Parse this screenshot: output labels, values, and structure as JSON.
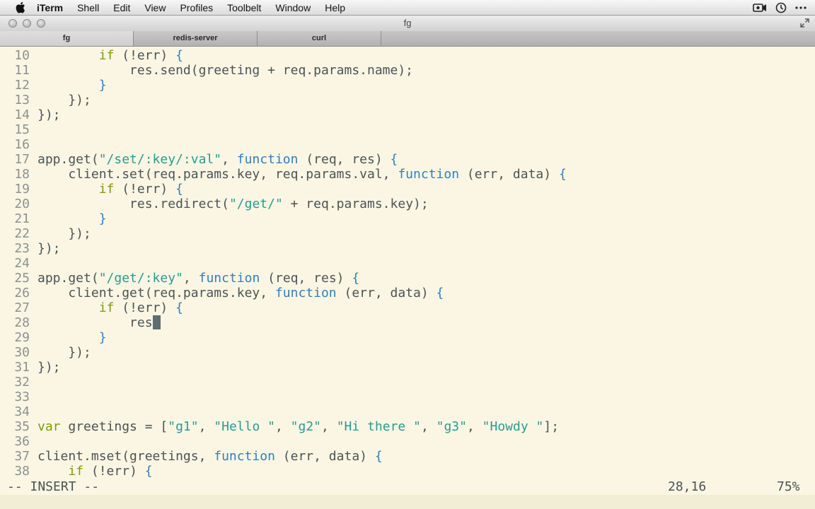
{
  "menubar": {
    "items": [
      "iTerm",
      "Shell",
      "Edit",
      "View",
      "Profiles",
      "Toolbelt",
      "Window",
      "Help"
    ]
  },
  "window": {
    "title": "fg",
    "tabs": [
      "fg",
      "redis-server",
      "curl"
    ]
  },
  "editor": {
    "lines": [
      {
        "num": "10",
        "segs": [
          {
            "t": "        "
          },
          {
            "t": "if",
            "c": "kw"
          },
          {
            "t": " (!err) "
          },
          {
            "t": "{",
            "c": "br"
          }
        ]
      },
      {
        "num": "11",
        "segs": [
          {
            "t": "            res.send(greeting + req.params.name);"
          }
        ]
      },
      {
        "num": "12",
        "segs": [
          {
            "t": "        "
          },
          {
            "t": "}",
            "c": "br"
          }
        ]
      },
      {
        "num": "13",
        "segs": [
          {
            "t": "    });"
          }
        ]
      },
      {
        "num": "14",
        "segs": [
          {
            "t": "});"
          }
        ]
      },
      {
        "num": "15",
        "segs": []
      },
      {
        "num": "16",
        "segs": []
      },
      {
        "num": "17",
        "segs": [
          {
            "t": "app.get("
          },
          {
            "t": "\"/set/:key/:val\"",
            "c": "str"
          },
          {
            "t": ", "
          },
          {
            "t": "function",
            "c": "fn"
          },
          {
            "t": " (req, res) "
          },
          {
            "t": "{",
            "c": "br"
          }
        ]
      },
      {
        "num": "18",
        "segs": [
          {
            "t": "    client.set(req.params.key, req.params.val, "
          },
          {
            "t": "function",
            "c": "fn"
          },
          {
            "t": " (err, data) "
          },
          {
            "t": "{",
            "c": "br"
          }
        ]
      },
      {
        "num": "19",
        "segs": [
          {
            "t": "        "
          },
          {
            "t": "if",
            "c": "kw"
          },
          {
            "t": " (!err) "
          },
          {
            "t": "{",
            "c": "br"
          }
        ]
      },
      {
        "num": "20",
        "segs": [
          {
            "t": "            res.redirect("
          },
          {
            "t": "\"/get/\"",
            "c": "str"
          },
          {
            "t": " + req.params.key);"
          }
        ]
      },
      {
        "num": "21",
        "segs": [
          {
            "t": "        "
          },
          {
            "t": "}",
            "c": "br"
          }
        ]
      },
      {
        "num": "22",
        "segs": [
          {
            "t": "    });"
          }
        ]
      },
      {
        "num": "23",
        "segs": [
          {
            "t": "});"
          }
        ]
      },
      {
        "num": "24",
        "segs": []
      },
      {
        "num": "25",
        "segs": [
          {
            "t": "app.get("
          },
          {
            "t": "\"/get/:key\"",
            "c": "str"
          },
          {
            "t": ", "
          },
          {
            "t": "function",
            "c": "fn"
          },
          {
            "t": " (req, res) "
          },
          {
            "t": "{",
            "c": "br"
          }
        ]
      },
      {
        "num": "26",
        "segs": [
          {
            "t": "    client.get(req.params.key, "
          },
          {
            "t": "function",
            "c": "fn"
          },
          {
            "t": " (err, data) "
          },
          {
            "t": "{",
            "c": "br"
          }
        ]
      },
      {
        "num": "27",
        "segs": [
          {
            "t": "        "
          },
          {
            "t": "if",
            "c": "kw"
          },
          {
            "t": " (!err) "
          },
          {
            "t": "{",
            "c": "br"
          }
        ]
      },
      {
        "num": "28",
        "segs": [
          {
            "t": "            res"
          }
        ],
        "cursor": true
      },
      {
        "num": "29",
        "segs": [
          {
            "t": "        "
          },
          {
            "t": "}",
            "c": "br"
          }
        ]
      },
      {
        "num": "30",
        "segs": [
          {
            "t": "    });"
          }
        ]
      },
      {
        "num": "31",
        "segs": [
          {
            "t": "});"
          }
        ]
      },
      {
        "num": "32",
        "segs": []
      },
      {
        "num": "33",
        "segs": []
      },
      {
        "num": "34",
        "segs": []
      },
      {
        "num": "35",
        "segs": [
          {
            "t": "var",
            "c": "kw"
          },
          {
            "t": " greetings = ["
          },
          {
            "t": "\"g1\"",
            "c": "str"
          },
          {
            "t": ", "
          },
          {
            "t": "\"Hello \"",
            "c": "str"
          },
          {
            "t": ", "
          },
          {
            "t": "\"g2\"",
            "c": "str"
          },
          {
            "t": ", "
          },
          {
            "t": "\"Hi there \"",
            "c": "str"
          },
          {
            "t": ", "
          },
          {
            "t": "\"g3\"",
            "c": "str"
          },
          {
            "t": ", "
          },
          {
            "t": "\"Howdy \"",
            "c": "str"
          },
          {
            "t": "];"
          }
        ]
      },
      {
        "num": "36",
        "segs": []
      },
      {
        "num": "37",
        "segs": [
          {
            "t": "client.mset(greetings, "
          },
          {
            "t": "function",
            "c": "fn"
          },
          {
            "t": " (err, data) "
          },
          {
            "t": "{",
            "c": "br"
          }
        ]
      },
      {
        "num": "38",
        "segs": [
          {
            "t": "    "
          },
          {
            "t": "if",
            "c": "kw"
          },
          {
            "t": " (!err) "
          },
          {
            "t": "{",
            "c": "br"
          }
        ]
      }
    ]
  },
  "statusline": {
    "mode": "-- INSERT --",
    "position": "28,16",
    "percent": "75%"
  },
  "colors": {
    "background": "#fbf6e3",
    "keyword": "#7d9c0a",
    "function": "#2f7fbf",
    "string": "#2a9a92",
    "text": "#4a5356",
    "line_number": "#8b9192"
  },
  "icons": [
    "apple-icon",
    "camera-icon",
    "clock-icon",
    "more-icon",
    "fullscreen-icon"
  ]
}
